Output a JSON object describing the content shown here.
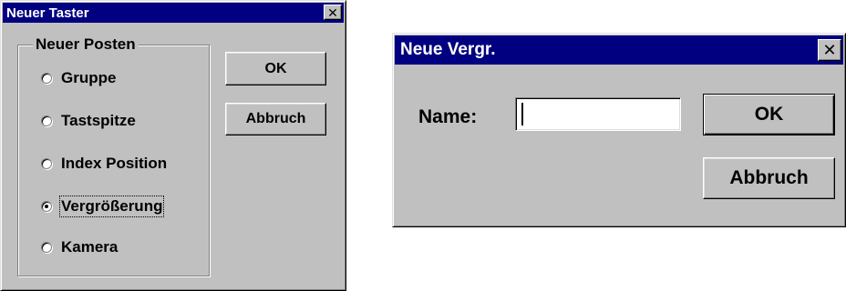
{
  "dialog_new_probe": {
    "title": "Neuer Taster",
    "close_glyph": "✕",
    "group": {
      "legend": "Neuer Posten",
      "options": [
        {
          "label": "Gruppe",
          "checked": false
        },
        {
          "label": "Tastspitze",
          "checked": false
        },
        {
          "label": "Index Position",
          "checked": false
        },
        {
          "label": "Vergrößerung",
          "checked": true
        },
        {
          "label": "Kamera",
          "checked": false
        }
      ]
    },
    "ok_label": "OK",
    "cancel_label": "Abbruch"
  },
  "dialog_new_magnification": {
    "title": "Neue Vergr.",
    "close_glyph": "✕",
    "name_label": "Name:",
    "name_value": "",
    "ok_label": "OK",
    "cancel_label": "Abbruch"
  },
  "colors": {
    "face": "#c0c0c0",
    "titlebar": "#000080",
    "title_text": "#ffffff",
    "field": "#ffffff"
  },
  "icons": {
    "close": "close-icon",
    "radio": "radio-icon"
  }
}
